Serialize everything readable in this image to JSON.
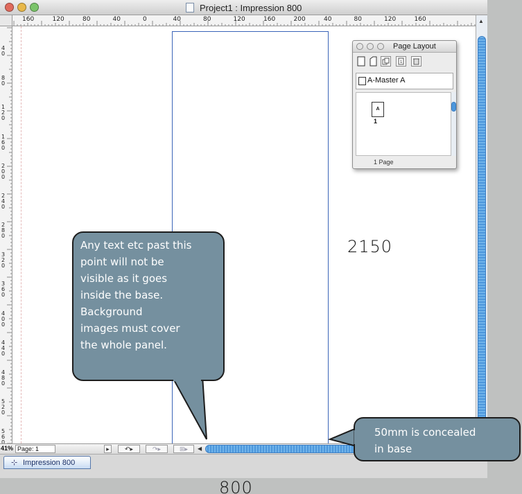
{
  "window": {
    "title": "Project1 : Impression 800"
  },
  "rulers": {
    "horizontal_labels": [
      "160",
      "120",
      "80",
      "40",
      "0",
      "40",
      "80",
      "120",
      "160",
      "200",
      "40",
      "80",
      "120",
      "160"
    ],
    "vertical_labels": [
      "40",
      "80",
      "120",
      "160",
      "200",
      "240",
      "280",
      "320",
      "360",
      "400",
      "440",
      "480",
      "520",
      "560"
    ]
  },
  "palette": {
    "title": "Page Layout",
    "master_label": "A-Master A",
    "page_thumb_letter": "A",
    "page_thumb_number": "1",
    "page_count": "1 Page"
  },
  "statusbar": {
    "zoom": "41%",
    "page_field": "Page: 1"
  },
  "tabbar": {
    "app_tab_label": "Impression 800"
  },
  "annotations": {
    "base_note": "Any text etc past this\npoint will not be\nvisible as it goes\ninside the base.\nBackground\nimages must cover\nthe whole panel.",
    "concealed_note": "50mm is concealed\nin base",
    "height_label": "2150",
    "width_label": "800"
  },
  "colors": {
    "callout_fill": "#75909f",
    "page_outline": "#3a64b8",
    "scroll_thumb": "#4d97dc",
    "backdrop": "#bfc1c0"
  },
  "icons": {
    "traffic_lights": [
      "close-button",
      "minimize-button",
      "zoom-button"
    ],
    "palette_tools": [
      "new-page-icon",
      "duplicate-page-icon",
      "master-page-icon",
      "delete-page-icon"
    ]
  }
}
